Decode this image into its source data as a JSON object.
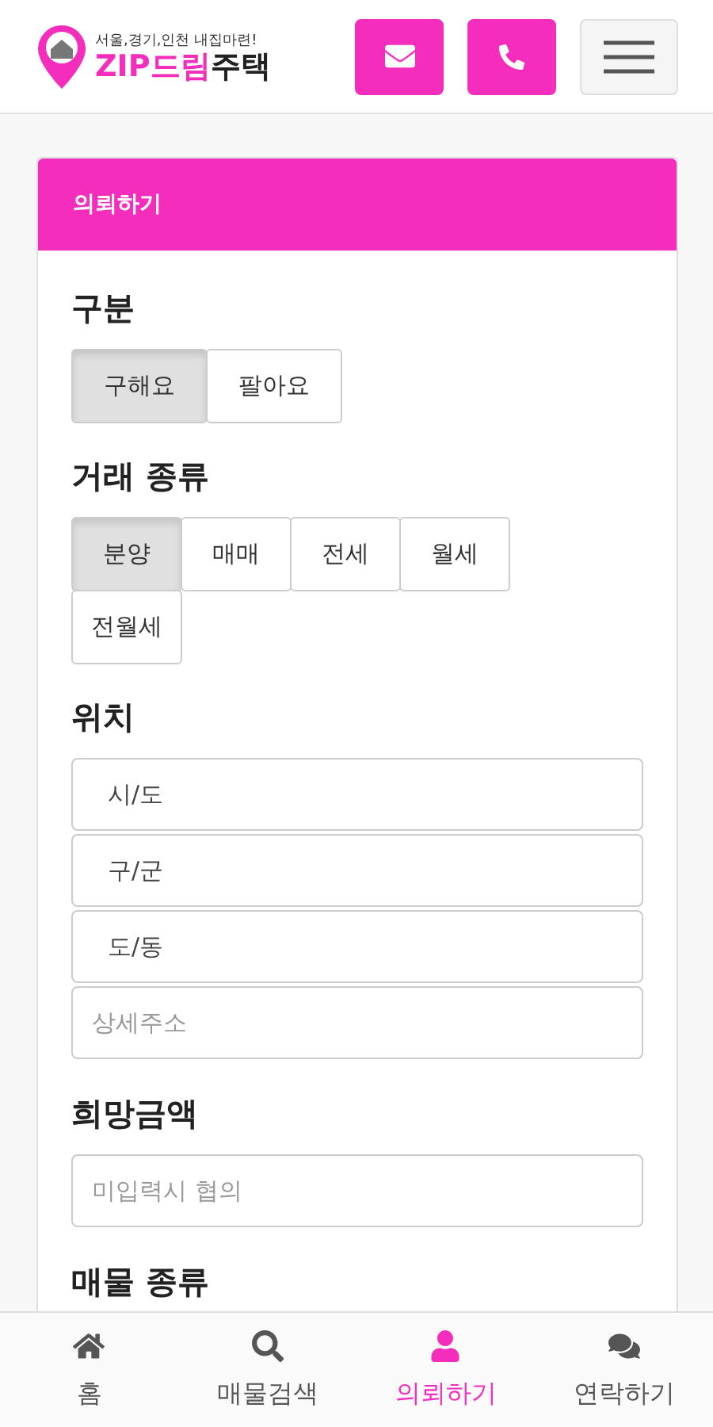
{
  "header": {
    "tagline": "서울,경기,인천 내집마련!",
    "brand": "ZIP드림",
    "brand_suffix": "주택",
    "buttons": [
      {
        "kind": "mail"
      },
      {
        "kind": "phone"
      },
      {
        "kind": "menu"
      }
    ]
  },
  "card": {
    "title": "의뢰하기",
    "sections": [
      {
        "kind": "options",
        "label": "구분",
        "options": [
          {
            "label": "구해요",
            "selected": true
          },
          {
            "label": "팔아요",
            "selected": false
          }
        ]
      },
      {
        "kind": "options",
        "label": "거래 종류",
        "options": [
          {
            "label": "분양",
            "selected": true
          },
          {
            "label": "매매",
            "selected": false
          },
          {
            "label": "전세",
            "selected": false
          },
          {
            "label": "월세",
            "selected": false
          },
          {
            "label": "전월세",
            "selected": false
          }
        ]
      },
      {
        "kind": "fields",
        "label": "위치",
        "fields": [
          {
            "kind": "select",
            "value": "시/도"
          },
          {
            "kind": "select",
            "value": "구/군"
          },
          {
            "kind": "select",
            "value": "도/동"
          },
          {
            "kind": "input",
            "placeholder": "상세주소"
          }
        ]
      },
      {
        "kind": "fields",
        "label": "희망금액",
        "fields": [
          {
            "kind": "input",
            "placeholder": "미입력시 협의"
          }
        ]
      },
      {
        "kind": "heading",
        "label": "매물 종류"
      }
    ]
  },
  "nav": [
    {
      "kind": "home",
      "label": "홈",
      "selected": false
    },
    {
      "kind": "search",
      "label": "매물검색",
      "selected": false
    },
    {
      "kind": "user",
      "label": "의뢰하기",
      "selected": true
    },
    {
      "kind": "chat",
      "label": "연락하기",
      "selected": false
    }
  ]
}
